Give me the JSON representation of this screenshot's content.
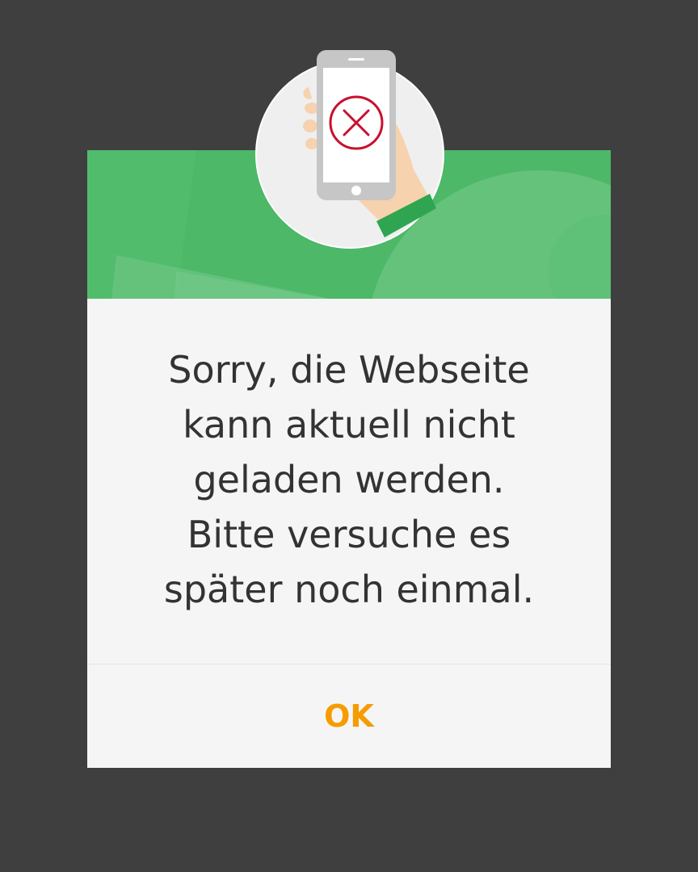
{
  "dialog": {
    "message": "Sorry, die Webseite\nkann aktuell nicht\ngeladen werden.\nBitte versuche es\nspäter noch einmal.",
    "ok_label": "OK"
  },
  "illustration": {
    "icon": "phone-error-icon",
    "error_symbol": "x-circle-icon"
  },
  "colors": {
    "backdrop": "#3f3f3f",
    "header_green": "#4cb868",
    "dialog_background": "#f5f5f5",
    "message_text": "#333333",
    "ok_orange": "#f59c00",
    "error_red": "#c8102e"
  }
}
